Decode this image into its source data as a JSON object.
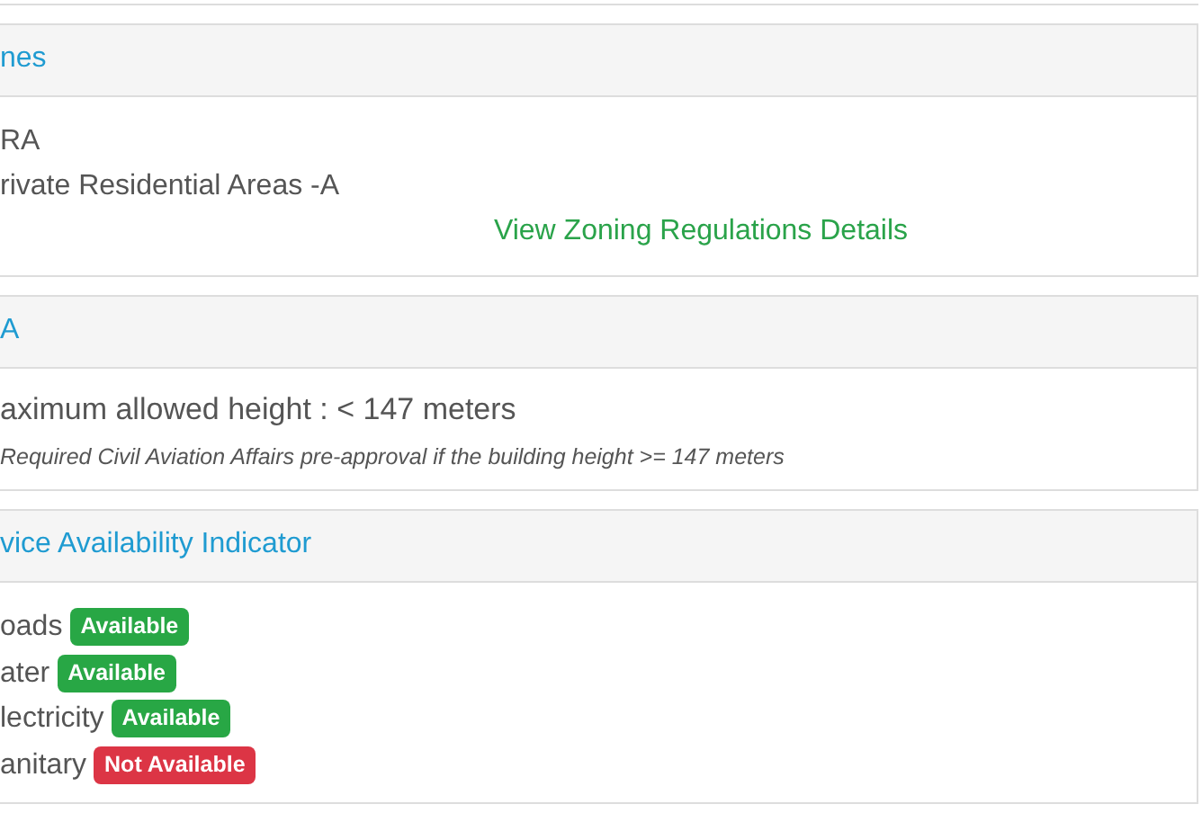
{
  "sections": [
    {
      "kind": "zone",
      "title": "nes",
      "code": "RA",
      "name": "rivate Residential Areas -A",
      "link": "View Zoning Regulations Details"
    },
    {
      "kind": "height",
      "title": "A",
      "limit": "aximum allowed height : < 147 meters",
      "note": "Required Civil Aviation Affairs pre-approval if the building height >= 147 meters"
    },
    {
      "kind": "services",
      "title": "vice Availability Indicator",
      "services": [
        {
          "name": "oads",
          "status": "Available",
          "available": true
        },
        {
          "name": "ater",
          "status": "Available",
          "available": true
        },
        {
          "name": "lectricity",
          "status": "Available",
          "available": true
        },
        {
          "name": "anitary",
          "status": "Not Available",
          "available": false
        }
      ]
    }
  ]
}
